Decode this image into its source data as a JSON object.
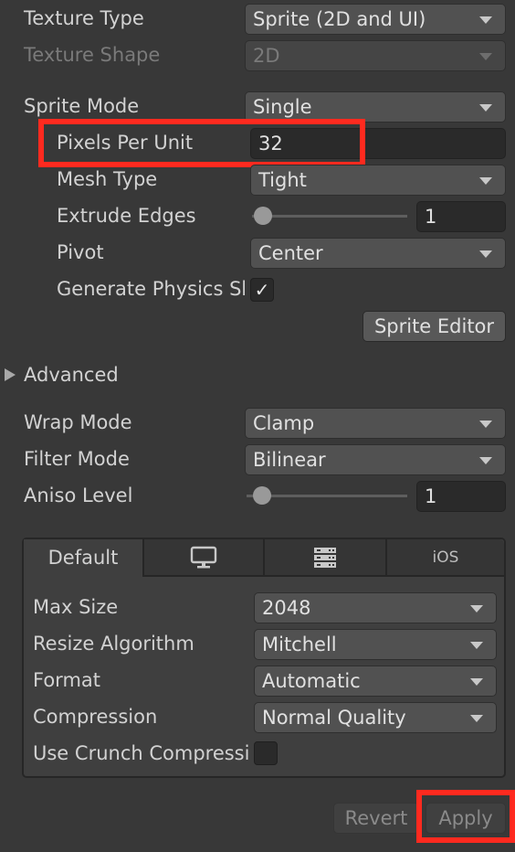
{
  "texture_type": {
    "label": "Texture Type",
    "value": "Sprite (2D and UI)"
  },
  "texture_shape": {
    "label": "Texture Shape",
    "value": "2D"
  },
  "sprite_mode": {
    "label": "Sprite Mode",
    "value": "Single"
  },
  "pixels_per_unit": {
    "label": "Pixels Per Unit",
    "value": "32"
  },
  "mesh_type": {
    "label": "Mesh Type",
    "value": "Tight"
  },
  "extrude_edges": {
    "label": "Extrude Edges",
    "value": "1"
  },
  "pivot": {
    "label": "Pivot",
    "value": "Center"
  },
  "generate_physics": {
    "label": "Generate Physics Shape",
    "checked": true,
    "check_glyph": "✓"
  },
  "sprite_editor_label": "Sprite Editor",
  "advanced_label": "Advanced",
  "wrap_mode": {
    "label": "Wrap Mode",
    "value": "Clamp"
  },
  "filter_mode": {
    "label": "Filter Mode",
    "value": "Bilinear"
  },
  "aniso_level": {
    "label": "Aniso Level",
    "value": "1"
  },
  "platform_tabs": [
    {
      "label": "Default",
      "active": true
    },
    {
      "icon": "monitor-icon"
    },
    {
      "icon": "server-icon"
    },
    {
      "label": "iOS"
    }
  ],
  "max_size": {
    "label": "Max Size",
    "value": "2048"
  },
  "resize_algorithm": {
    "label": "Resize Algorithm",
    "value": "Mitchell"
  },
  "format": {
    "label": "Format",
    "value": "Automatic"
  },
  "compression": {
    "label": "Compression",
    "value": "Normal Quality"
  },
  "use_crunch": {
    "label": "Use Crunch Compression",
    "checked": false
  },
  "revert_label": "Revert",
  "apply_label": "Apply",
  "highlight_color": "#ff2a1f"
}
